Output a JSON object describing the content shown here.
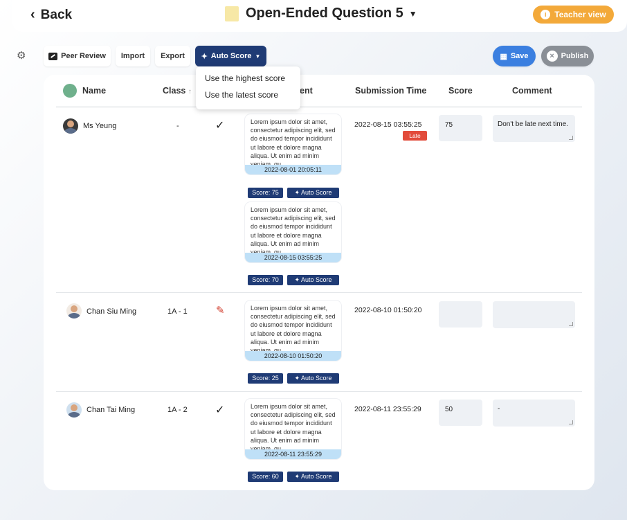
{
  "header": {
    "back_label": "Back",
    "title": "Open-Ended Question 5",
    "teacher_view_label": "Teacher view"
  },
  "toolbar": {
    "peer_review_label": "Peer Review",
    "import_label": "Import",
    "export_label": "Export",
    "auto_score_label": "Auto Score",
    "save_label": "Save",
    "publish_label": "Publish"
  },
  "auto_score_menu": {
    "items": [
      "Use the highest score",
      "Use the latest score"
    ]
  },
  "table": {
    "headers": {
      "name": "Name",
      "class": "Class",
      "answer_partial": "ent",
      "submission_time": "Submission Time",
      "score": "Score",
      "comment": "Comment"
    },
    "rows": [
      {
        "name": "Ms Yeung",
        "class": "-",
        "status": "checked",
        "submissions": [
          {
            "text": "Lorem ipsum dolor sit amet, consectetur adipiscing elit, sed do eiusmod tempor incididunt ut labore et dolore magna aliqua. Ut enim ad minim veniam, qu...",
            "time": "2022-08-01 20:05:11",
            "score": "Score: 75",
            "auto": "Auto Score"
          },
          {
            "text": "Lorem ipsum dolor sit amet, consectetur adipiscing elit, sed do eiusmod tempor incididunt ut labore et dolore magna aliqua. Ut enim ad minim veniam, qu...",
            "time": "2022-08-15 03:55:25",
            "score": "Score: 70",
            "auto": "Auto Score"
          }
        ],
        "submission_time": "2022-08-15 03:55:25",
        "late_label": "Late",
        "score": "75",
        "comment": "Don't be late next time."
      },
      {
        "name": "Chan Siu Ming",
        "class": "1A - 1",
        "status": "edit",
        "submissions": [
          {
            "text": "Lorem ipsum dolor sit amet, consectetur adipiscing elit, sed do eiusmod tempor incididunt ut labore et dolore magna aliqua. Ut enim ad minim veniam, qu...",
            "time": "2022-08-10 01:50:20",
            "score": "Score: 25",
            "auto": "Auto Score"
          }
        ],
        "submission_time": "2022-08-10 01:50:20",
        "score": "",
        "comment": ""
      },
      {
        "name": "Chan Tai Ming",
        "class": "1A - 2",
        "status": "checked",
        "submissions": [
          {
            "text": "Lorem ipsum dolor sit amet, consectetur adipiscing elit, sed do eiusmod tempor incididunt ut labore et dolore magna aliqua. Ut enim ad minim veniam, qu...",
            "time": "2022-08-11 23:55:29",
            "score": "Score: 60",
            "auto": "Auto Score"
          }
        ],
        "submission_time": "2022-08-11 23:55:29",
        "score": "50",
        "comment": "-"
      }
    ]
  },
  "icons": {
    "back": "chevron-left-icon",
    "title": "note-icon",
    "title_caret": "caret-down-icon",
    "teacher": "info-icon",
    "settings": "gear-icon",
    "peer_review": "pen-box-icon",
    "auto_score": "sparkle-icon",
    "save": "save-icon",
    "publish": "close-icon",
    "checked": "check-icon",
    "edit": "pencil-icon"
  },
  "colors": {
    "primary": "#1f3b75",
    "save": "#3b7fe0",
    "teacher_view": "#f3a93a",
    "late": "#e24b3b",
    "time_bar": "#bfe0f7",
    "publish": "#8a8f96"
  }
}
